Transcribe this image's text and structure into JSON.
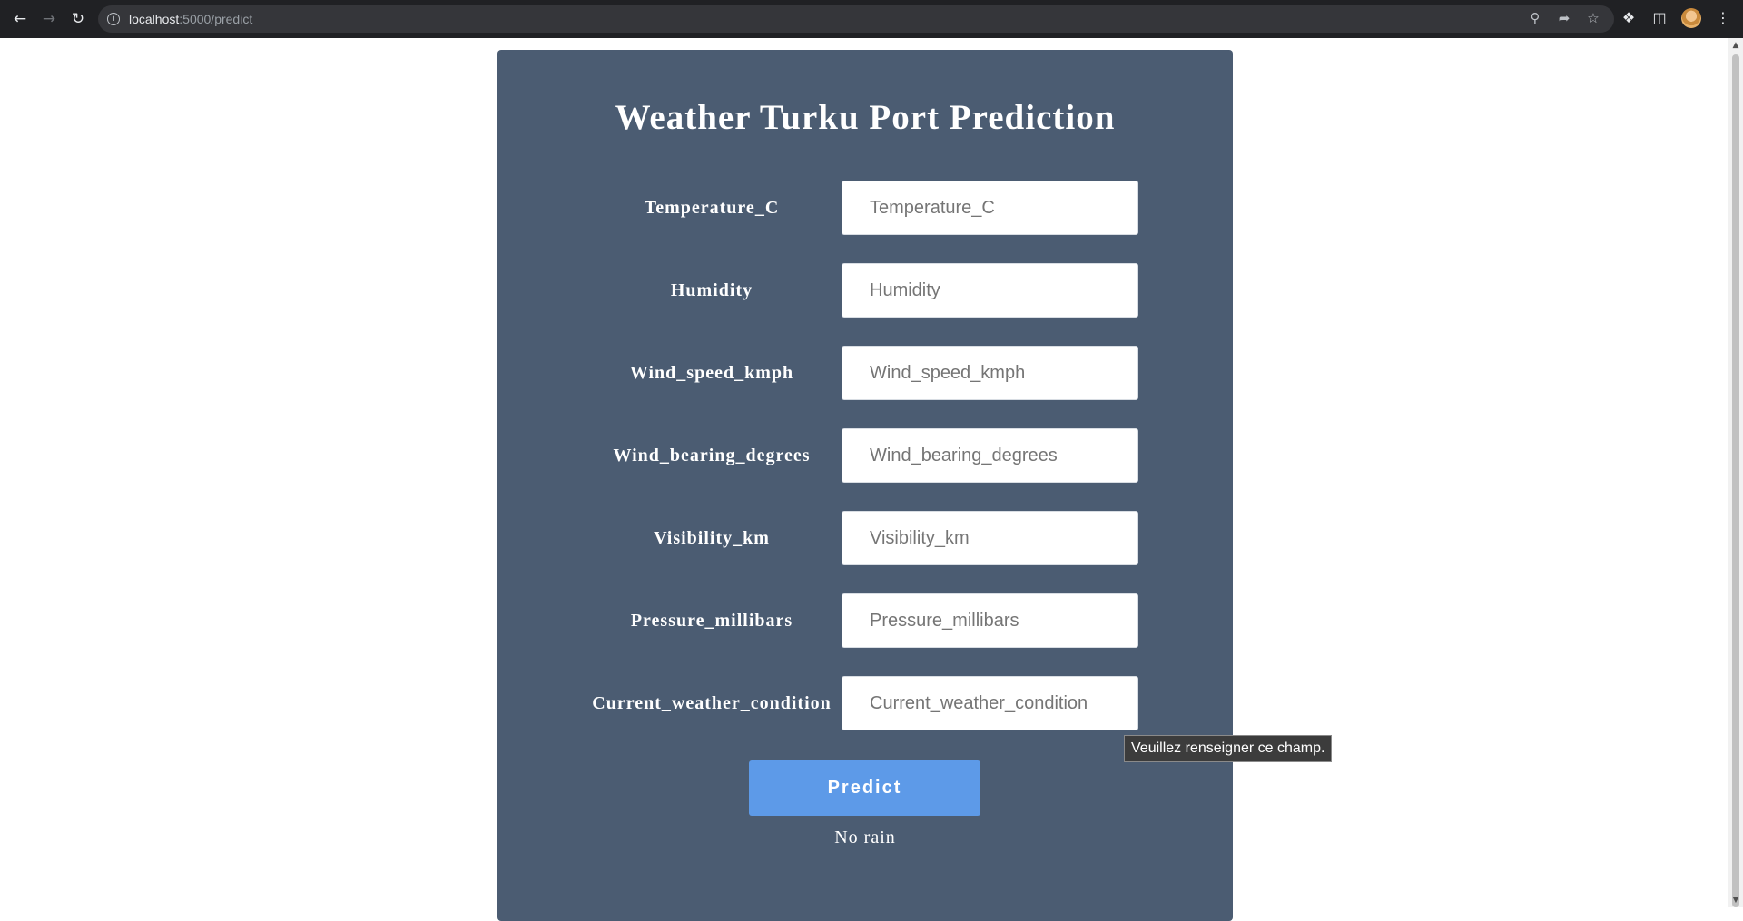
{
  "browser": {
    "url_host": "localhost",
    "url_path": ":5000/predict",
    "icons": {
      "back": "arrow-left-icon",
      "forward": "arrow-right-icon",
      "reload": "reload-icon",
      "site_info": "info-icon",
      "zoom": "zoom-icon",
      "share": "share-icon",
      "bookmark": "star-icon",
      "extensions": "puzzle-icon",
      "side_panel": "side-panel-icon",
      "profile": "avatar",
      "menu": "kebab-menu-icon"
    }
  },
  "page": {
    "title": "Weather Turku Port Prediction",
    "fields": [
      {
        "label": "Temperature_C",
        "placeholder": "Temperature_C"
      },
      {
        "label": "Humidity",
        "placeholder": "Humidity"
      },
      {
        "label": "Wind_speed_kmph",
        "placeholder": "Wind_speed_kmph"
      },
      {
        "label": "Wind_bearing_degrees",
        "placeholder": "Wind_bearing_degrees"
      },
      {
        "label": "Visibility_km",
        "placeholder": "Visibility_km"
      },
      {
        "label": "Pressure_millibars",
        "placeholder": "Pressure_millibars"
      },
      {
        "label": "Current_weather_condition",
        "placeholder": "Current_weather_condition"
      }
    ],
    "predict_button": "Predict",
    "result": "No rain",
    "validation_tooltip": "Veuillez renseigner ce champ."
  },
  "colors": {
    "card_background": "#4b5c72",
    "button_background": "#5d9ae8",
    "chrome_background": "#202124"
  }
}
